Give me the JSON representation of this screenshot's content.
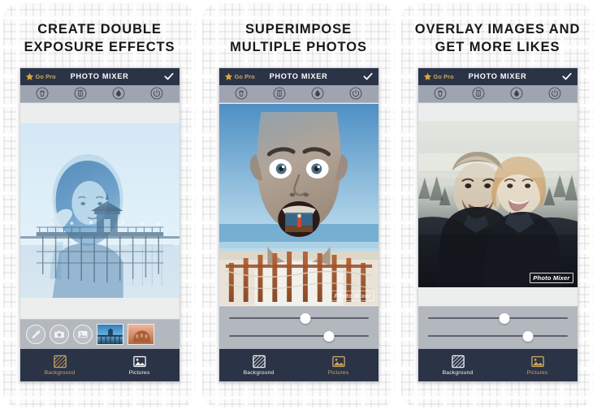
{
  "page": {
    "background_pattern": "concentric-square-maze",
    "card_count": 3
  },
  "colors": {
    "appbar_navy": "#2b3447",
    "toolbar_gray": "#9fa5b0",
    "controls_gray": "#b3b7be",
    "gold_accent": "#c9a55f",
    "white": "#ffffff",
    "headline_text": "#16181c"
  },
  "app": {
    "title": "PHOTO MIXER",
    "gopro_label": "Go Pro",
    "star_icon": "star-icon",
    "confirm_icon": "checkmark-icon",
    "watermark": "Photo Mixer",
    "tools": [
      {
        "name": "delete-tool",
        "icon": "trash-icon"
      },
      {
        "name": "contrast-tool",
        "icon": "contrast-circle-icon"
      },
      {
        "name": "blur-tool",
        "icon": "droplet-icon"
      },
      {
        "name": "reset-tool",
        "icon": "rotate-icon"
      }
    ],
    "tabs": {
      "background": {
        "label": "Background",
        "icon": "hatched-square-icon"
      },
      "pictures": {
        "label": "Pictures",
        "icon": "photo-icon"
      }
    }
  },
  "cards": [
    {
      "headline_line1": "CREATE DOUBLE",
      "headline_line2": "EXPOSURE EFFECTS",
      "photo": "blue-double-exposure-portrait-with-pier",
      "watermark_visible": false,
      "bottom_mode": "picker",
      "active_tab": "background",
      "picker_buttons": [
        {
          "name": "eyedropper-button",
          "icon": "eyedropper-icon"
        },
        {
          "name": "camera-button",
          "icon": "camera-icon"
        },
        {
          "name": "gallery-button",
          "icon": "image-icon"
        }
      ],
      "thumbnails": [
        {
          "name": "thumbnail-pier",
          "description": "blue pier photo"
        },
        {
          "name": "thumbnail-colosseum",
          "description": "orange colosseum photo"
        }
      ]
    },
    {
      "headline_line1": "SUPERIMPOSE",
      "headline_line2": "MULTIPLE PHOTOS",
      "photo": "surprised-face-over-beach-pier",
      "watermark_visible": true,
      "watermark_style": "faint",
      "bottom_mode": "sliders",
      "active_tab": "pictures",
      "sliders": [
        {
          "name": "opacity-slider",
          "value": 55
        },
        {
          "name": "blend-slider",
          "value": 72
        }
      ]
    },
    {
      "headline_line1": "OVERLAY IMAGES AND",
      "headline_line2": "GET MORE LIKES",
      "photo": "couple-double-exposure-with-forest",
      "watermark_visible": true,
      "watermark_style": "solid",
      "bottom_mode": "sliders",
      "active_tab": "pictures",
      "sliders": [
        {
          "name": "opacity-slider",
          "value": 55
        },
        {
          "name": "blend-slider",
          "value": 72
        }
      ]
    }
  ]
}
